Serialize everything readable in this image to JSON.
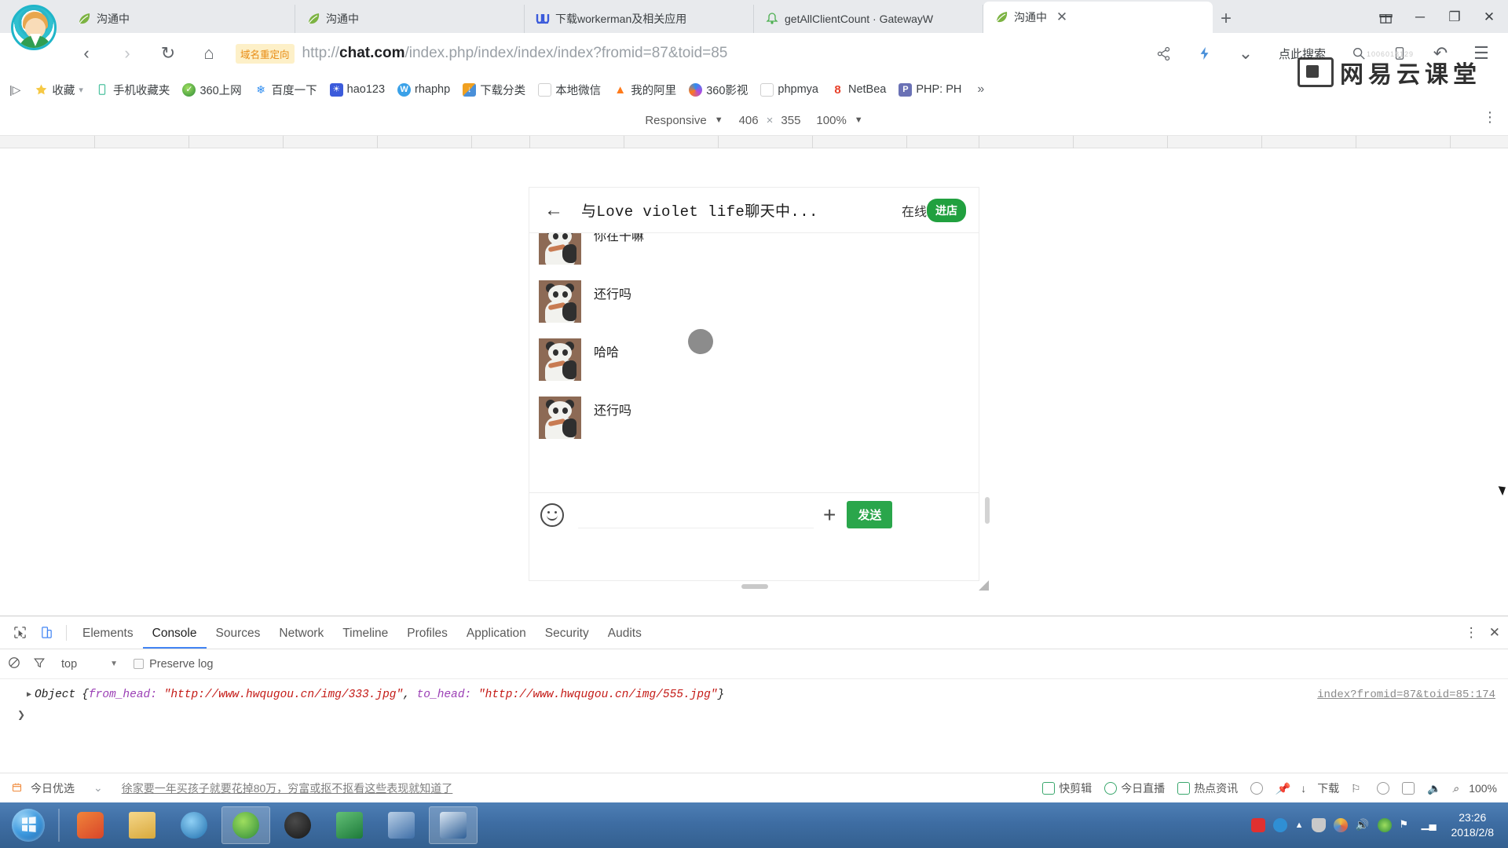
{
  "browser": {
    "tabs": [
      {
        "label": "沟通中",
        "icon": "leaf-icon",
        "active": false
      },
      {
        "label": "沟通中",
        "icon": "leaf-icon",
        "active": false
      },
      {
        "label": "下载workerman及相关应用",
        "icon": "w-icon",
        "active": false
      },
      {
        "label": "getAllClientCount · GatewayW",
        "icon": "bell-icon",
        "active": false
      },
      {
        "label": "沟通中",
        "icon": "leaf-icon",
        "active": true
      }
    ],
    "new_tab_label": "+",
    "window_controls": {
      "gift": "☐",
      "minimize": "─",
      "maximize": "❐",
      "close": "✕"
    },
    "nav": {
      "back": "‹",
      "forward": "›",
      "reload": "↻",
      "home": "⌂",
      "redirect_badge": "域名重定向",
      "url_scheme": "http://",
      "url_host": "chat.com",
      "url_path": "/index.php/index/index/index?fromid=87&toid=85",
      "search_hint": "点此搜索",
      "share": "share-icon",
      "lightning": "lightning-icon",
      "chevron": "⌄",
      "search": "⌕",
      "mobile": "mobile-icon",
      "undo": "↶",
      "menu": "☰",
      "grid": "grid-icon"
    },
    "bookmarks": {
      "leading_chevron": "|▷",
      "items": [
        {
          "label": "收藏",
          "icon": "star-icon",
          "color": "#f6c945",
          "has_caret": true
        },
        {
          "label": "手机收藏夹",
          "icon": "phone-icon",
          "color": "#4fc3a1",
          "has_caret": false
        },
        {
          "label": "360上网",
          "icon": "360-icon",
          "color": "#3cab46",
          "has_caret": false
        },
        {
          "label": "百度一下",
          "icon": "baidu-icon",
          "color": "#2d8cf0",
          "has_caret": false
        },
        {
          "label": "hao123",
          "icon": "hao123-icon",
          "color": "#3b5bdb",
          "has_caret": false
        },
        {
          "label": "rhaphp",
          "icon": "w-circle-icon",
          "color": "#3aa1e8",
          "has_caret": false
        },
        {
          "label": "下载分类",
          "icon": "download-icon",
          "color": "#f0a020",
          "has_caret": false
        },
        {
          "label": "本地微信",
          "icon": "page-icon",
          "color": "#cfcfcf",
          "has_caret": false
        },
        {
          "label": "我的阿里",
          "icon": "ali-icon",
          "color": "#ff7a1a",
          "has_caret": false
        },
        {
          "label": "360影视",
          "icon": "360video-icon",
          "color": "#b14ae0",
          "has_caret": false
        },
        {
          "label": "phpmya",
          "icon": "page-icon",
          "color": "#cfcfcf",
          "has_caret": false
        },
        {
          "label": "NetBea",
          "icon": "netbeans-icon",
          "color": "#e8402a",
          "has_caret": false
        },
        {
          "label": "PHP: PH",
          "icon": "php-icon",
          "color": "#6a71b5",
          "has_caret": false
        }
      ],
      "overflow": "»"
    }
  },
  "device_toolbar": {
    "device_label": "Responsive",
    "device_caret": "▼",
    "width": "406",
    "times": "×",
    "height": "355",
    "zoom": "100%",
    "zoom_caret": "▼",
    "kebab": "⋮"
  },
  "chat_app": {
    "back_icon": "←",
    "title": "与Love violet life聊天中...",
    "status": "在线",
    "enter_shop_button": "进店",
    "messages": [
      {
        "avatar": "panda-avatar",
        "text": "你在干嘛"
      },
      {
        "avatar": "panda-avatar",
        "text": "还行吗"
      },
      {
        "avatar": "panda-avatar",
        "text": "哈哈"
      },
      {
        "avatar": "panda-avatar",
        "text": "还行吗"
      }
    ],
    "composer": {
      "emoji_icon": "smiley-icon",
      "input_value": "",
      "input_placeholder": "",
      "plus_label": "+",
      "send_label": "发送"
    }
  },
  "devtools": {
    "inspect_icon": "inspect-cursor-icon",
    "device_icon": "device-toolbar-icon",
    "tabs": [
      {
        "label": "Elements",
        "active": false
      },
      {
        "label": "Console",
        "active": true
      },
      {
        "label": "Sources",
        "active": false
      },
      {
        "label": "Network",
        "active": false
      },
      {
        "label": "Timeline",
        "active": false
      },
      {
        "label": "Profiles",
        "active": false
      },
      {
        "label": "Application",
        "active": false
      },
      {
        "label": "Security",
        "active": false
      },
      {
        "label": "Audits",
        "active": false
      }
    ],
    "more_icon": "⋮",
    "close_icon": "✕",
    "filterbar": {
      "clear_icon": "clear-console-icon",
      "filter_icon": "filter-icon",
      "context": "top",
      "context_caret": "▼",
      "preserve_log_label": "Preserve log",
      "preserve_log_checked": false
    },
    "console": {
      "expand_triangle": "▶",
      "object_label": "Object",
      "open_brace": "{",
      "entries": [
        {
          "key": "from_head:",
          "value": "\"http://www.hwqugou.cn/img/333.jpg\""
        },
        {
          "key": "to_head:",
          "value": "\"http://www.hwqugou.cn/img/555.jpg\""
        }
      ],
      "close_brace": "}",
      "source_link": "index?fromid=87&toid=85:174",
      "prompt": "❯"
    }
  },
  "status_bar": {
    "left_label": "今日优选",
    "collapse_icon": "⌄",
    "news": "徐家要一年买孩子就要花掉80万，穷富或抠不抠看这些表现就知道了",
    "right_items": [
      {
        "label": "快剪辑",
        "icon": "clip-icon"
      },
      {
        "label": "今日直播",
        "icon": "live-icon"
      },
      {
        "label": "热点资讯",
        "icon": "news-icon"
      },
      {
        "label": "",
        "icon": "flower-icon"
      },
      {
        "label": "",
        "icon": "pin-icon"
      },
      {
        "label": "下载",
        "icon": "download-arrow-icon"
      },
      {
        "label": "",
        "icon": "flag-icon"
      },
      {
        "label": "",
        "icon": "mouse-icon"
      },
      {
        "label": "",
        "icon": "window-icon"
      },
      {
        "label": "",
        "icon": "volume-icon"
      },
      {
        "label": "100%",
        "icon": "zoom-icon"
      }
    ]
  },
  "taskbar": {
    "start_label": "start-orb",
    "items": [
      {
        "name": "app-360-safe",
        "color": "#e8642d",
        "active": false
      },
      {
        "name": "app-explorer-folder",
        "color": "#e8c268",
        "active": false
      },
      {
        "name": "app-ie-browser",
        "color": "#2f8fd4",
        "active": false
      },
      {
        "name": "app-360-browser",
        "color": "#3aa74f",
        "active": true
      },
      {
        "name": "app-obs",
        "color": "#2b2b2b",
        "active": false
      },
      {
        "name": "app-editor",
        "color": "#2f9e52",
        "active": false
      },
      {
        "name": "app-phpstudy",
        "color": "#4b7fbd",
        "active": false
      },
      {
        "name": "app-navicat",
        "color": "#3d6fa8",
        "active": true
      }
    ],
    "tray": [
      {
        "name": "tray-sogou",
        "color": "#e03030"
      },
      {
        "name": "tray-help",
        "color": "#2f8fd4"
      },
      {
        "name": "tray-caret",
        "color": "#ffffff"
      },
      {
        "name": "tray-shield",
        "color": "#c9c9c9"
      },
      {
        "name": "tray-chrome",
        "color": "#f0c040"
      },
      {
        "name": "tray-volume",
        "color": "#ffffff"
      },
      {
        "name": "tray-360",
        "color": "#3aa74f"
      },
      {
        "name": "tray-flag",
        "color": "#ffffff"
      },
      {
        "name": "tray-network",
        "color": "#ffffff"
      }
    ],
    "clock_time": "23:26",
    "clock_date": "2018/2/8"
  },
  "watermark": {
    "text": "网易云课堂",
    "sub": "1006018129"
  },
  "colors": {
    "accent_green": "#21a03f",
    "send_green": "#2aa64b",
    "devtools_active": "#4285f4",
    "redirect_badge_bg": "#fdf0c8",
    "redirect_badge_fg": "#e88b12",
    "taskbar_blue": "#3e6da3"
  }
}
